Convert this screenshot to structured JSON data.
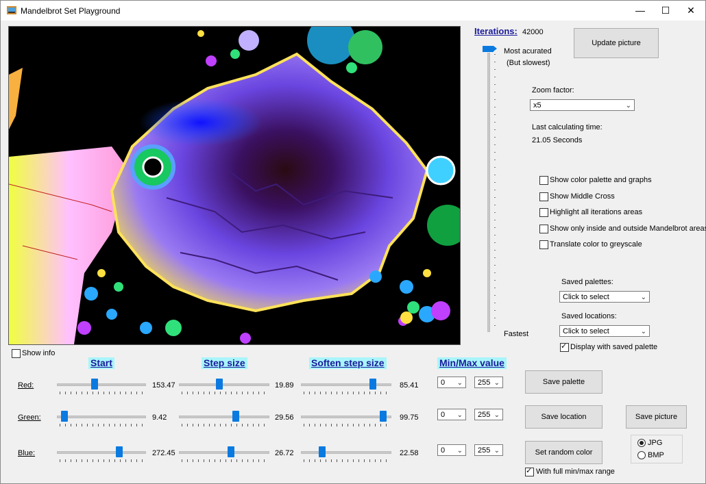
{
  "window": {
    "title": "Mandelbrot Set Playground",
    "min": "—",
    "max": "☐",
    "close": "✕"
  },
  "iterations": {
    "label": "Iterations:",
    "value": "42000",
    "top_label": "Most acurated",
    "top_sub": "(But slowest)",
    "bottom_label": "Fastest"
  },
  "buttons": {
    "update": "Update picture",
    "save_palette": "Save  palette",
    "save_location": "Save location",
    "save_picture": "Save picture",
    "random_color": "Set random color"
  },
  "zoom": {
    "label": "Zoom factor:",
    "value": "x5"
  },
  "calc": {
    "label": "Last calculating time:",
    "value": "21.05 Seconds"
  },
  "options": [
    {
      "label": "Show color palette and graphs",
      "checked": false
    },
    {
      "label": "Show Middle Cross",
      "checked": false
    },
    {
      "label": "Highlight all iterations areas",
      "checked": false
    },
    {
      "label": "Show only inside and outside Mandelbrot areas",
      "checked": false
    },
    {
      "label": "Translate color to greyscale",
      "checked": false
    }
  ],
  "saved": {
    "palettes_label": "Saved palettes:",
    "palettes_value": "Click to select",
    "locations_label": "Saved locations:",
    "locations_value": "Click to select",
    "display_label": "Display with saved palette"
  },
  "show_info": "Show info",
  "headers": {
    "start": "Start",
    "step": "Step size",
    "soften": "Soften step size",
    "minmax": "Min/Max value"
  },
  "rows": [
    {
      "label": "Red:",
      "start": "153.47",
      "start_frac": 0.42,
      "step": "19.89",
      "step_frac": 0.45,
      "soften": "85.41",
      "soften_frac": 0.83,
      "min": "0",
      "max": "255"
    },
    {
      "label": "Green:",
      "start": "9.42",
      "start_frac": 0.05,
      "step": "29.56",
      "step_frac": 0.65,
      "soften": "99.75",
      "soften_frac": 0.96,
      "min": "0",
      "max": "255"
    },
    {
      "label": "Blue:",
      "start": "272.45",
      "start_frac": 0.73,
      "step": "26.72",
      "step_frac": 0.59,
      "soften": "22.58",
      "soften_frac": 0.22,
      "min": "0",
      "max": "255"
    }
  ],
  "format": {
    "jpg": "JPG",
    "bmp": "BMP",
    "selected": "JPG"
  },
  "full_range_label": "With full min/max range",
  "colors": {
    "accent": "#0a7ae0",
    "header_bg": "#a9f5fb",
    "header_fg": "#1a1a9a"
  }
}
